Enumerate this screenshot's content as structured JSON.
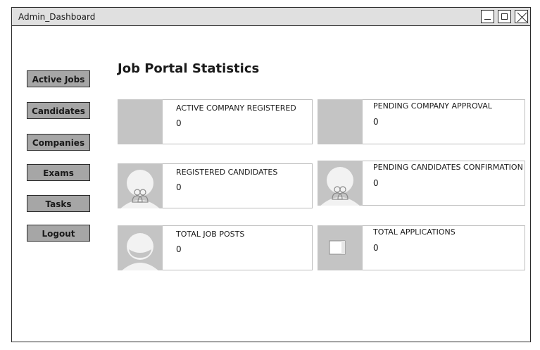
{
  "window": {
    "title": "Admin_Dashboard"
  },
  "sidebar": {
    "items": [
      {
        "label": "Active Jobs"
      },
      {
        "label": "Candidates"
      },
      {
        "label": "Companies"
      },
      {
        "label": "Exams"
      },
      {
        "label": "Tasks"
      },
      {
        "label": "Logout"
      }
    ]
  },
  "main": {
    "heading": "Job Portal Statistics",
    "stats": [
      {
        "label": "ACTIVE COMPANY REGISTERED",
        "value": "0",
        "icon": "placeholder-image-icon"
      },
      {
        "label": "PENDING COMPANY APPROVAL",
        "value": "0",
        "icon": "placeholder-image-icon"
      },
      {
        "label": "REGISTERED CANDIDATES",
        "value": "0",
        "icon": "user-group-icon"
      },
      {
        "label": "PENDING CANDIDATES CONFIRMATION",
        "value": "0",
        "icon": "user-group-icon"
      },
      {
        "label": "TOTAL JOB POSTS",
        "value": "0",
        "icon": "user-avatar-icon"
      },
      {
        "label": "TOTAL APPLICATIONS",
        "value": "0",
        "icon": "document-icon"
      }
    ]
  }
}
